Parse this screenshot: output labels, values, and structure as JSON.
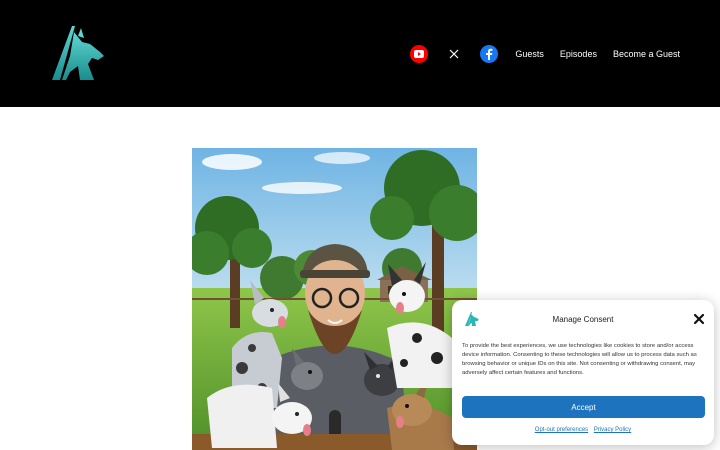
{
  "header": {
    "nav": {
      "guests": "Guests",
      "episodes": "Episodes",
      "become_guest": "Become a Guest"
    },
    "social_icons": [
      "youtube-icon",
      "x-icon",
      "facebook-icon"
    ]
  },
  "consent": {
    "title": "Manage Consent",
    "body": "To provide the best experiences, we use technologies like cookies to store and/or access device information. Consenting to these technologies will allow us to process data such as browsing behavior or unique IDs on this site. Not consenting or withdrawing consent, may adversely affect certain features and functions.",
    "accept": "Accept",
    "opt_out": "Opt-out preferences",
    "privacy": "Privacy Policy"
  },
  "colors": {
    "header_bg": "#000000",
    "brand_teal": "#2ab7b4",
    "accept_bg": "#1e73be",
    "youtube": "#ff0000",
    "facebook": "#1877f2"
  }
}
